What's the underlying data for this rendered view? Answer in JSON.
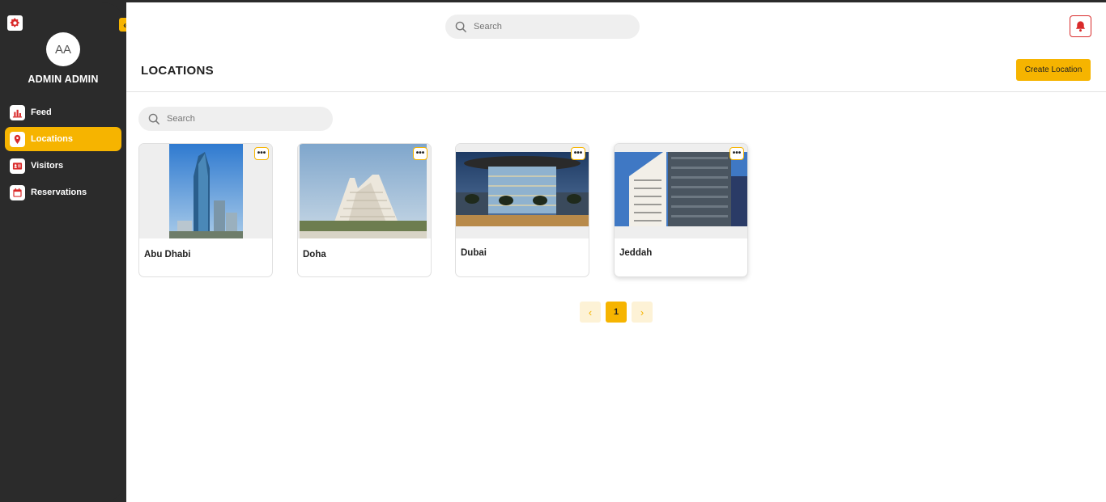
{
  "sidebar": {
    "avatar_initials": "AA",
    "user_name": "ADMIN ADMIN",
    "collapse_glyph": "«",
    "items": [
      {
        "label": "Feed",
        "icon": "bar-chart-icon",
        "active": false
      },
      {
        "label": "Locations",
        "icon": "map-pin-icon",
        "active": true
      },
      {
        "label": "Visitors",
        "icon": "id-card-icon",
        "active": false
      },
      {
        "label": "Reservations",
        "icon": "calendar-icon",
        "active": false
      }
    ]
  },
  "header": {
    "search_placeholder": "Search"
  },
  "page": {
    "title": "LOCATIONS",
    "create_label": "Create Location",
    "search_placeholder": "Search"
  },
  "locations": [
    {
      "name": "Abu Dhabi",
      "more": "•••"
    },
    {
      "name": "Doha",
      "more": "•••"
    },
    {
      "name": "Dubai",
      "more": "•••"
    },
    {
      "name": "Jeddah",
      "more": "•••"
    }
  ],
  "pagination": {
    "prev": "‹",
    "current": "1",
    "next": "›"
  },
  "colors": {
    "accent": "#f6b400",
    "sidebar_bg": "#2b2b2b",
    "icon_red": "#d92b2b"
  }
}
